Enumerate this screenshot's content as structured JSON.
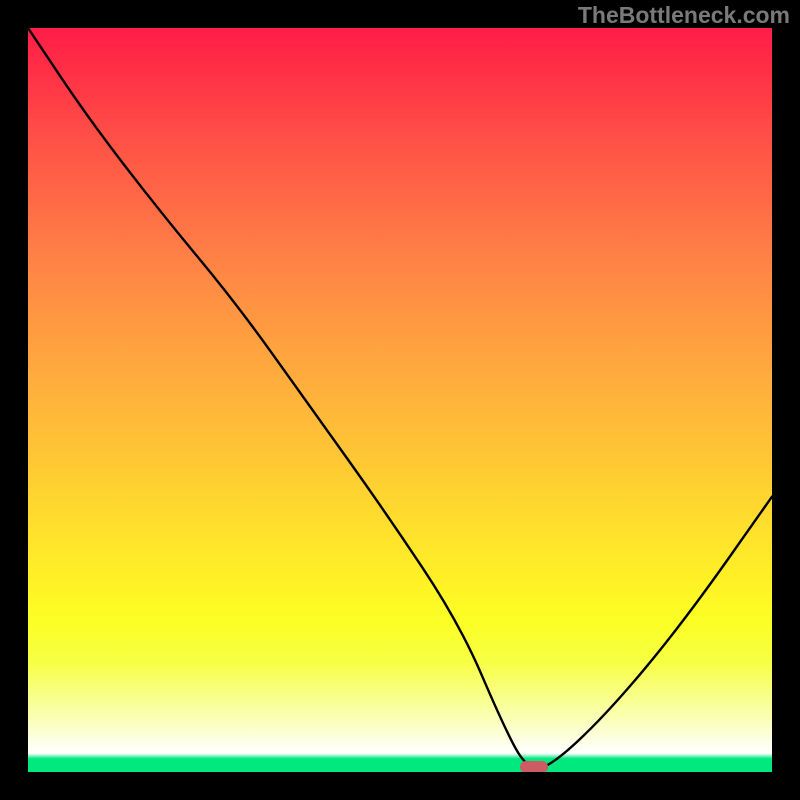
{
  "watermark_text": "TheBottleneck.com",
  "chart_data": {
    "type": "line",
    "title": "",
    "xlabel": "",
    "ylabel": "",
    "xlim": [
      0,
      100
    ],
    "ylim": [
      0,
      100
    ],
    "x": [
      0,
      8,
      18,
      28,
      38,
      48,
      58,
      64,
      67,
      70,
      78,
      88,
      100
    ],
    "values": [
      100,
      88,
      75,
      63,
      49,
      35,
      20,
      6,
      0.5,
      0.5,
      8,
      20,
      37
    ],
    "note": "Values are relative percentages read from the vertical position of the black curve; 0 = bottom (green band), 100 = top. The curve descends from top-left, inflects slightly near x≈28, dips to a flat valley near x≈67–70, then rises again toward the right edge.",
    "valley_marker": {
      "x": 68,
      "y": 0.7
    },
    "gradient_stops": [
      {
        "pos": 0,
        "color": "#ff1d47"
      },
      {
        "pos": 0.5,
        "color": "#ffb63a"
      },
      {
        "pos": 0.8,
        "color": "#fbff25"
      },
      {
        "pos": 0.975,
        "color": "#ffffff"
      },
      {
        "pos": 1.0,
        "color": "#00e87e"
      }
    ],
    "watermark_color": "#7a7a7a"
  },
  "plot_geometry": {
    "inner_left": 28,
    "inner_top": 28,
    "inner_width": 744,
    "inner_height": 744
  }
}
